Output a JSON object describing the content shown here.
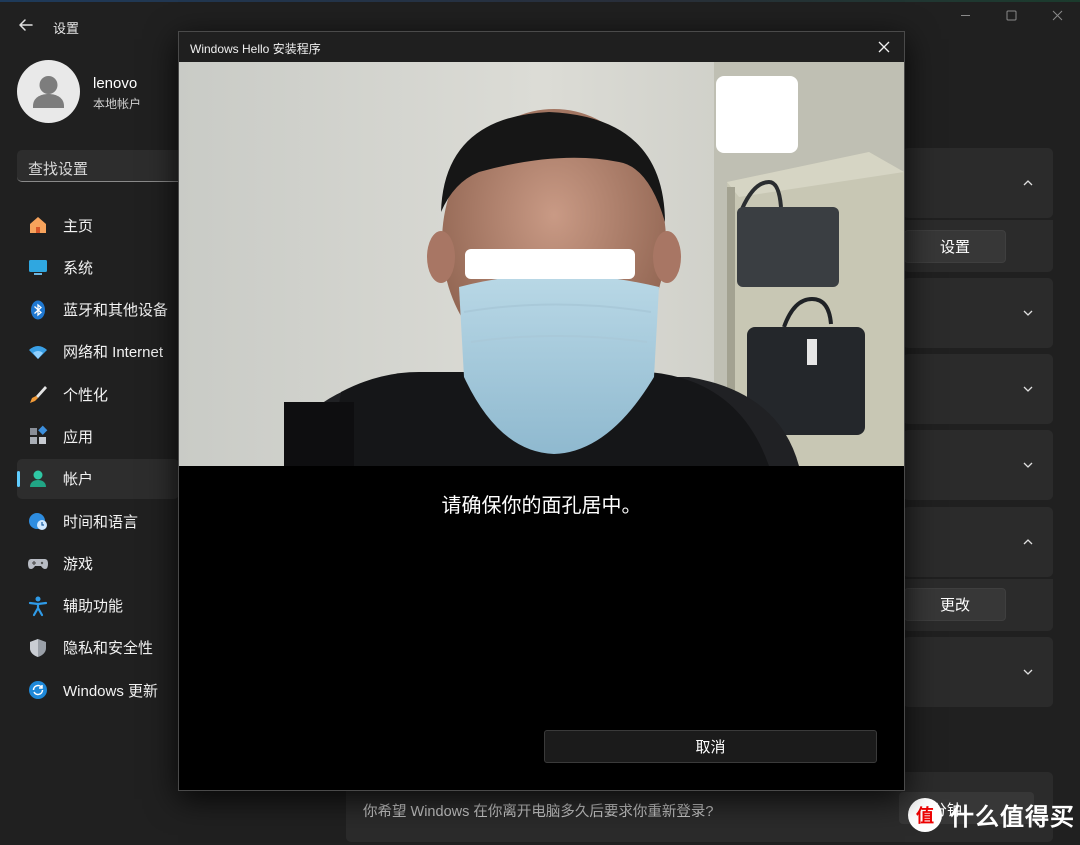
{
  "app": {
    "title": "设置"
  },
  "user": {
    "name": "lenovo",
    "account_type": "本地帐户"
  },
  "search": {
    "placeholder": "查找设置"
  },
  "nav": {
    "items": [
      {
        "label": "主页",
        "icon": "home-icon"
      },
      {
        "label": "系统",
        "icon": "monitor-icon"
      },
      {
        "label": "蓝牙和其他设备",
        "icon": "bluetooth-icon"
      },
      {
        "label": "网络和 Internet",
        "icon": "wifi-icon"
      },
      {
        "label": "个性化",
        "icon": "brush-icon"
      },
      {
        "label": "应用",
        "icon": "apps-icon"
      },
      {
        "label": "帐户",
        "icon": "person-icon",
        "active": true
      },
      {
        "label": "时间和语言",
        "icon": "globe-clock-icon"
      },
      {
        "label": "游戏",
        "icon": "gamepad-icon"
      },
      {
        "label": "辅助功能",
        "icon": "accessibility-icon"
      },
      {
        "label": "隐私和安全性",
        "icon": "shield-icon"
      },
      {
        "label": "Windows 更新",
        "icon": "update-icon"
      }
    ]
  },
  "main": {
    "buttons": {
      "setup": "设置",
      "change": "更改"
    },
    "bottom_question": "你希望 Windows 在你离开电脑多久后要求你重新登录?",
    "bottom_select_value": "15 分钟"
  },
  "dialog": {
    "title": "Windows Hello 安装程序",
    "instruction": "请确保你的面孔居中。",
    "cancel_label": "取消"
  },
  "watermark": {
    "badge": "值",
    "text": "什么值得买"
  },
  "colors": {
    "accent": "#60cdff",
    "background": "#202020",
    "card": "#2b2b2b"
  }
}
